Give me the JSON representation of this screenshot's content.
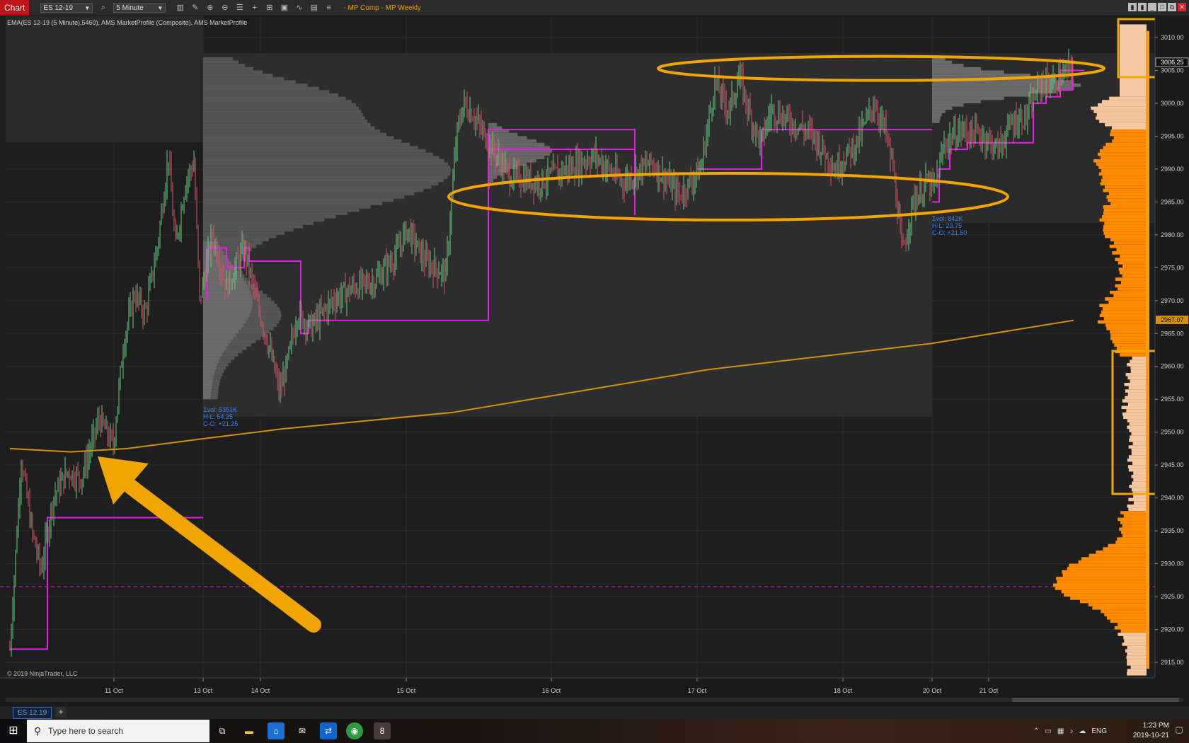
{
  "window": {
    "tab_label": "Chart",
    "instrument": "ES 12-19",
    "interval": "5 Minute",
    "title": "- MP Comp  - MP Weekly"
  },
  "chart": {
    "indicators_label": "EMA(ES 12-19 (5 Minute),5460), AMS MarketProfile (Composite), AMS MarketProfile",
    "copyright": "© 2019 NinjaTrader, LLC",
    "x_ticks": [
      "11 Oct",
      "13 Oct",
      "14 Oct",
      "15 Oct",
      "16 Oct",
      "17 Oct",
      "18 Oct",
      "20 Oct",
      "21 Oct"
    ],
    "y_ticks": [
      "3010.00",
      "3005.00",
      "3000.00",
      "2995.00",
      "2990.00",
      "2985.00",
      "2980.00",
      "2975.00",
      "2970.00",
      "2965.00",
      "2960.00",
      "2955.00",
      "2950.00",
      "2945.00",
      "2940.00",
      "2935.00",
      "2930.00",
      "2925.00",
      "2920.00",
      "2915.00"
    ],
    "y_range": [
      2912,
      3013
    ],
    "last_price": "3006.25",
    "ema_value": "2967.07",
    "stats_left": [
      "Σvol: 5351K",
      "H-L: 54.25",
      "C-O: +21.25"
    ],
    "stats_right": [
      "Σvol: 842K",
      "H-L: 23.75",
      "C-O: +21.50"
    ],
    "colors": {
      "ema": "#d4900a",
      "value_area": "#e81ce8",
      "annotation": "#f0a500",
      "up": "#5fcf7d",
      "down": "#d9546b",
      "volume_profile": "#ff8c00"
    }
  },
  "tabs": {
    "instrument_tab": "ES 12.19",
    "add_tab": "+"
  },
  "taskbar": {
    "search_placeholder": "Type here to search",
    "time": "1:23 PM",
    "date": "2019-10-21",
    "language": "ENG",
    "badge": "8"
  }
}
